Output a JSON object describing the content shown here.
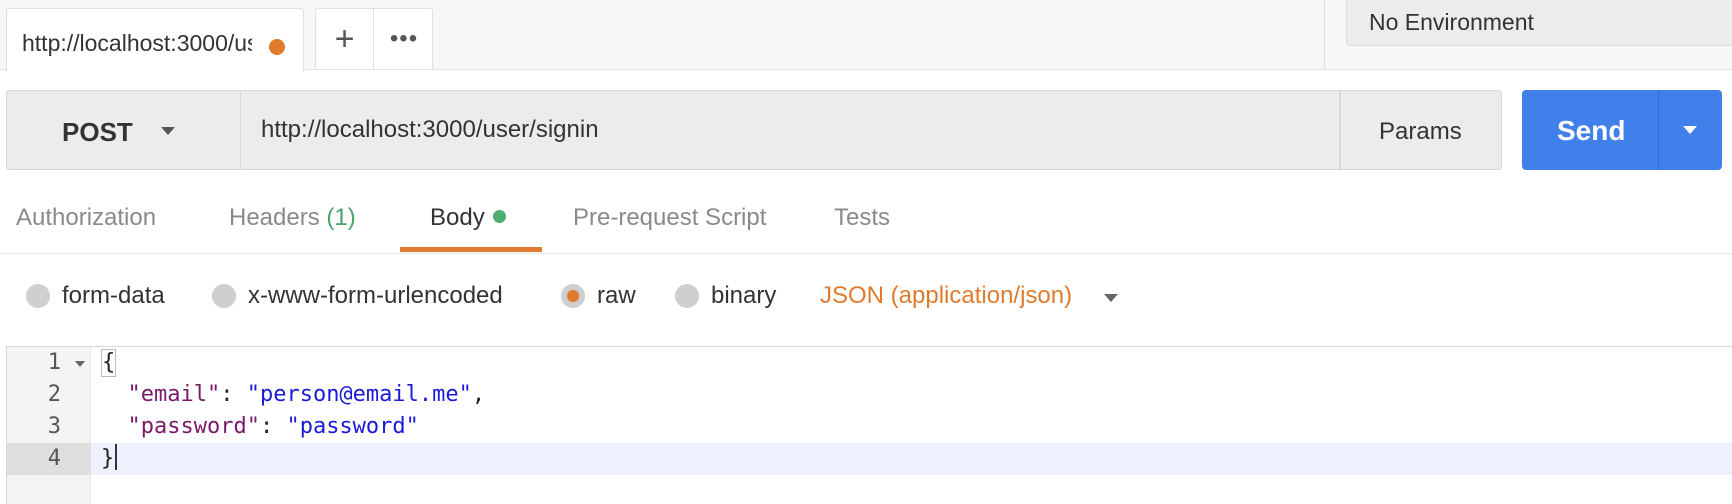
{
  "tab_bar": {
    "active_tab": "http://localhost:3000/user/signin",
    "new_tab_icon": "plus-icon",
    "more_icon": "ellipsis-icon",
    "environment": "No Environment"
  },
  "request": {
    "method": "POST",
    "url": "http://localhost:3000/user/signin",
    "params_label": "Params",
    "send_label": "Send"
  },
  "section_tabs": {
    "authorization": "Authorization",
    "headers": "Headers",
    "headers_count": "(1)",
    "body": "Body",
    "pre_request": "Pre-request Script",
    "tests": "Tests",
    "active": "Body"
  },
  "body_types": {
    "form_data": "form-data",
    "urlencoded": "x-www-form-urlencoded",
    "raw": "raw",
    "binary": "binary",
    "selected": "raw",
    "content_type": "JSON (application/json)"
  },
  "editor": {
    "lines": [
      {
        "num": "1",
        "text": "{"
      },
      {
        "num": "2",
        "key": "\"email\"",
        "value": "\"person@email.me\""
      },
      {
        "num": "3",
        "key": "\"password\"",
        "value": "\"password\""
      },
      {
        "num": "4",
        "text": "}"
      }
    ],
    "active_line": "4"
  },
  "colors": {
    "accent": "#e07b2e",
    "send": "#3f80ea",
    "count_green": "#4aa36b",
    "json_key": "#7a1a6a",
    "json_string": "#1a1ad8"
  }
}
